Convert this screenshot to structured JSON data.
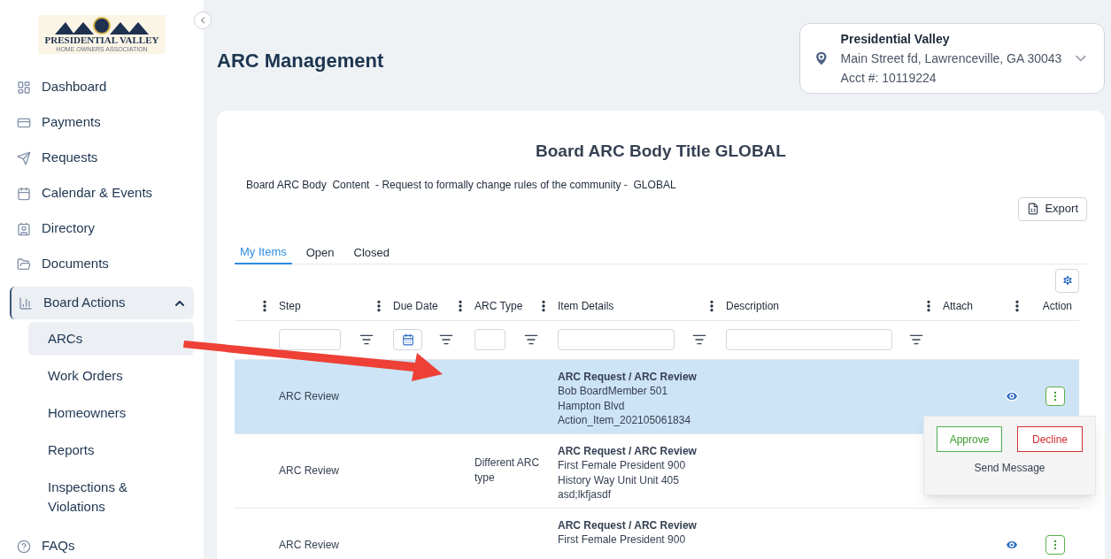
{
  "logo": {
    "name": "PRESIDENTIAL VALLEY",
    "tagline": "HOME OWNERS ASSOCIATION"
  },
  "sidebar": {
    "items": [
      {
        "label": "Dashboard",
        "selected": false
      },
      {
        "label": "Payments",
        "selected": false
      },
      {
        "label": "Requests",
        "selected": false
      },
      {
        "label": "Calendar & Events",
        "selected": false
      },
      {
        "label": "Directory",
        "selected": false
      },
      {
        "label": "Documents",
        "selected": false
      },
      {
        "label": "Board Actions",
        "selected": true,
        "expanded": true,
        "children": [
          {
            "label": "ARCs",
            "selected": true
          },
          {
            "label": "Work Orders",
            "selected": false
          },
          {
            "label": "Homeowners",
            "selected": false
          },
          {
            "label": "Reports",
            "selected": false
          },
          {
            "label": "Inspections & Violations",
            "selected": false
          }
        ]
      },
      {
        "label": "FAQs",
        "selected": false
      }
    ]
  },
  "page_title": "ARC Management",
  "account": {
    "name": "Presidential Valley",
    "address": "Main Street fd, Lawrenceville, GA 30043",
    "acct": "Acct #: 10119224"
  },
  "card": {
    "title": "Board ARC Body Title GLOBAL",
    "content": "Board ARC Body  Content  - Request to formally change rules of the community -  GLOBAL",
    "export_button": "Export"
  },
  "tabs": [
    {
      "label": "My Items",
      "selected": true
    },
    {
      "label": "Open",
      "selected": false
    },
    {
      "label": "Closed",
      "selected": false
    }
  ],
  "table": {
    "columns": [
      "Step",
      "Due Date",
      "ARC Type",
      "Item Details",
      "Description",
      "Attach",
      "Action"
    ],
    "rows": [
      {
        "selected": true,
        "step": "ARC Review",
        "title": "ARC Request / ARC Review",
        "details": [
          "Bob BoardMember 501",
          "Hampton Blvd",
          "Action_Item_202105061834"
        ]
      },
      {
        "selected": false,
        "step": "ARC Review",
        "arc_type": "Different ARC type",
        "title": "ARC Request / ARC Review",
        "details": [
          "First Female President 900",
          "History Way Unit Unit 405",
          "asd;lkfjasdf"
        ]
      },
      {
        "selected": false,
        "step": "ARC Review",
        "title": "ARC Request / ARC Review",
        "details": [
          "First Female President 900"
        ]
      }
    ]
  },
  "action_menu": {
    "approve": "Approve",
    "decline": "Decline",
    "send_message": "Send Message"
  }
}
